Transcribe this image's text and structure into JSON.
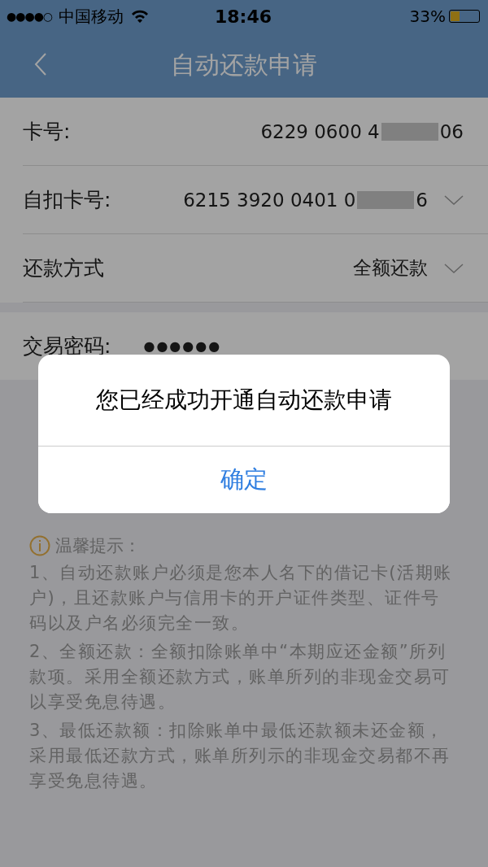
{
  "status_bar": {
    "signal": "●●●●○",
    "carrier": "中国移动",
    "time": "18:46",
    "battery_text": "33%",
    "battery": {
      "level": 0.33
    }
  },
  "nav": {
    "title": "自动还款申请"
  },
  "form_rows": [
    {
      "kind": "text",
      "label": "卡号:",
      "value_start": "6229 0600 4",
      "value_end": "06",
      "masked": true
    },
    {
      "kind": "select",
      "label": "自扣卡号:",
      "value_start": "6215 3920 0401 0",
      "value_end": "6",
      "masked": true
    },
    {
      "kind": "select",
      "label": "还款方式",
      "value_start": "全额还款",
      "masked": false
    }
  ],
  "password": {
    "label": "交易密码:",
    "value": "●●●●●●"
  },
  "tips": {
    "title": "温馨提示：",
    "items": [
      "1、自动还款账户必须是您本人名下的借记卡(活期账户)，且还款账户与信用卡的开户证件类型、证件号码以及户名必须完全一致。",
      "2、全额还款：全额扣除账单中“本期应还金额”所列款项。采用全额还款方式，账单所列的非现金交易可以享受免息待遇。",
      "3、最低还款额：扣除账单中最低还款额未还金额，采用最低还款方式，账单所列示的非现金交易都不再享受免息待遇。"
    ]
  },
  "dialog": {
    "visible": true,
    "message": "您已经成功开通自动还款申请",
    "button": "确定"
  }
}
